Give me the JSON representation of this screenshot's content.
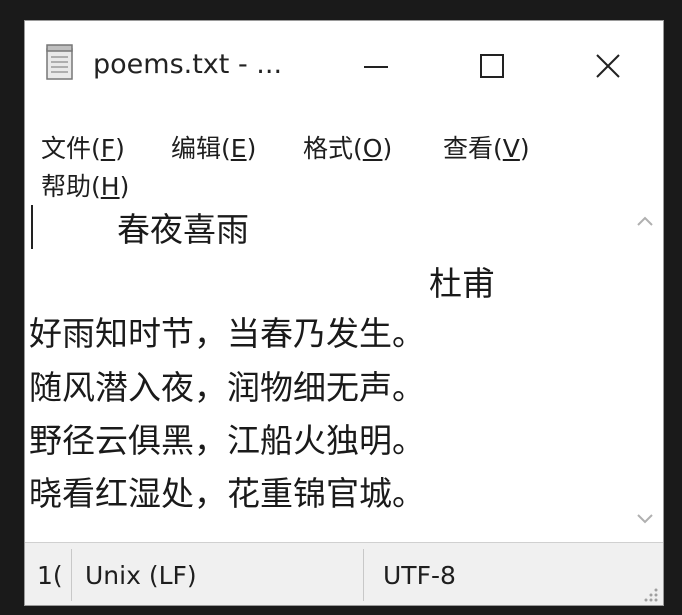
{
  "window": {
    "title": "poems.txt - ...",
    "icon": "notepad-icon"
  },
  "controls": {
    "minimize_icon": "minimize-icon",
    "maximize_icon": "maximize-icon",
    "close_icon": "close-icon"
  },
  "menu": {
    "items": [
      {
        "label": "文件(",
        "key": "F",
        "tail": ")"
      },
      {
        "label": "编辑(",
        "key": "E",
        "tail": ")"
      },
      {
        "label": "格式(",
        "key": "O",
        "tail": ")"
      },
      {
        "label": "查看(",
        "key": "V",
        "tail": ")"
      },
      {
        "label": "帮助(",
        "key": "H",
        "tail": ")"
      }
    ]
  },
  "document": {
    "title": "春夜喜雨",
    "author": "杜甫",
    "lines": [
      "好雨知时节，当春乃发生。",
      "随风潜入夜，润物细无声。",
      "野径云俱黑，江船火独明。",
      "晓看红湿处，花重锦官城。"
    ]
  },
  "statusbar": {
    "position_fragment": "1(",
    "line_ending": "Unix (LF)",
    "encoding": "UTF-8"
  },
  "colors": {
    "background": "#1a1a1a",
    "window": "#ffffff",
    "statusbar": "#f0f0f0"
  }
}
